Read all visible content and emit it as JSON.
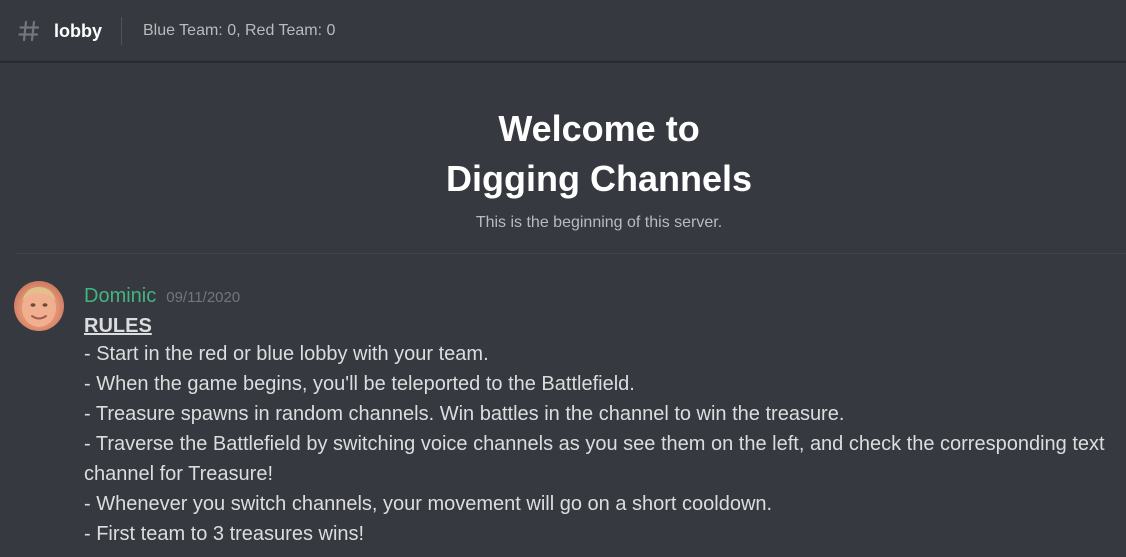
{
  "header": {
    "channel_name": "lobby",
    "topic": "Blue Team: 0, Red Team: 0"
  },
  "welcome": {
    "line1": "Welcome to",
    "line2": "Digging Channels",
    "subtitle": "This is the beginning of this server."
  },
  "message": {
    "author": "Dominic",
    "timestamp": "09/11/2020",
    "title": "RULES",
    "lines": [
      "- Start in the red or blue lobby with your team.",
      "- When the game begins, you'll be teleported to the Battlefield.",
      "- Treasure spawns in random channels. Win battles in the channel to win the treasure.",
      "- Traverse the Battlefield by switching voice channels as you see them on the left, and check the corresponding text channel for Treasure!",
      "- Whenever you switch channels, your movement will go on a short cooldown.",
      "- First team to 3 treasures wins!"
    ]
  },
  "colors": {
    "background": "#36393f",
    "author": "#43b581",
    "text": "#dcddde",
    "muted": "#72767d"
  },
  "icons": {
    "channel": "hash-icon",
    "avatar": "avatar"
  }
}
